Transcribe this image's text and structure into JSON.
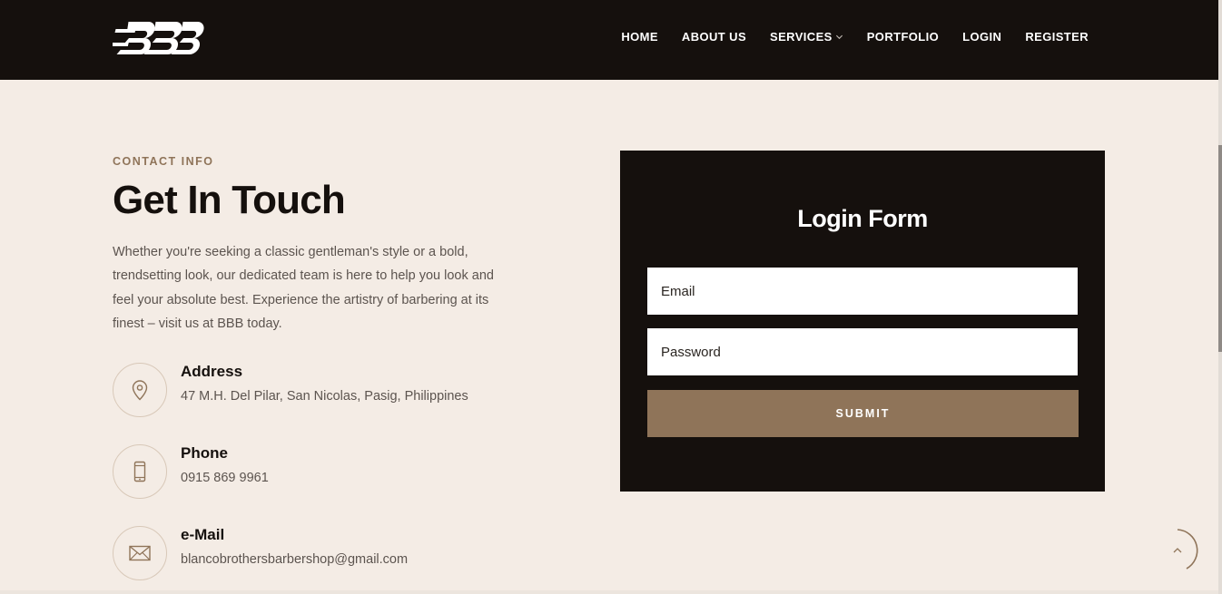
{
  "brand": {
    "logo_text": "BBB"
  },
  "nav": {
    "items": [
      {
        "label": "HOME"
      },
      {
        "label": "ABOUT US"
      },
      {
        "label": "SERVICES"
      },
      {
        "label": "PORTFOLIO"
      },
      {
        "label": "LOGIN"
      },
      {
        "label": "REGISTER"
      }
    ]
  },
  "contact": {
    "eyebrow": "CONTACT INFO",
    "heading": "Get In Touch",
    "intro": "Whether you're seeking a classic gentleman's style or a bold, trendsetting look, our dedicated team is here to help you look and feel your absolute best. Experience the artistry of barbering at its finest – visit us at BBB today.",
    "items": [
      {
        "title": "Address",
        "value": "47 M.H. Del Pilar, San Nicolas, Pasig, Philippines",
        "icon": "map-pin-icon"
      },
      {
        "title": "Phone",
        "value": "0915 869 9961",
        "icon": "phone-icon"
      },
      {
        "title": "e-Mail",
        "value": "blancobrothersbarbershop@gmail.com",
        "icon": "envelope-icon"
      }
    ]
  },
  "login_form": {
    "title": "Login Form",
    "email_placeholder": "Email",
    "password_placeholder": "Password",
    "submit_label": "SUBMIT"
  },
  "colors": {
    "dark": "#15100d",
    "background": "#f4ece5",
    "accent": "#8f7459",
    "white": "#ffffff"
  }
}
